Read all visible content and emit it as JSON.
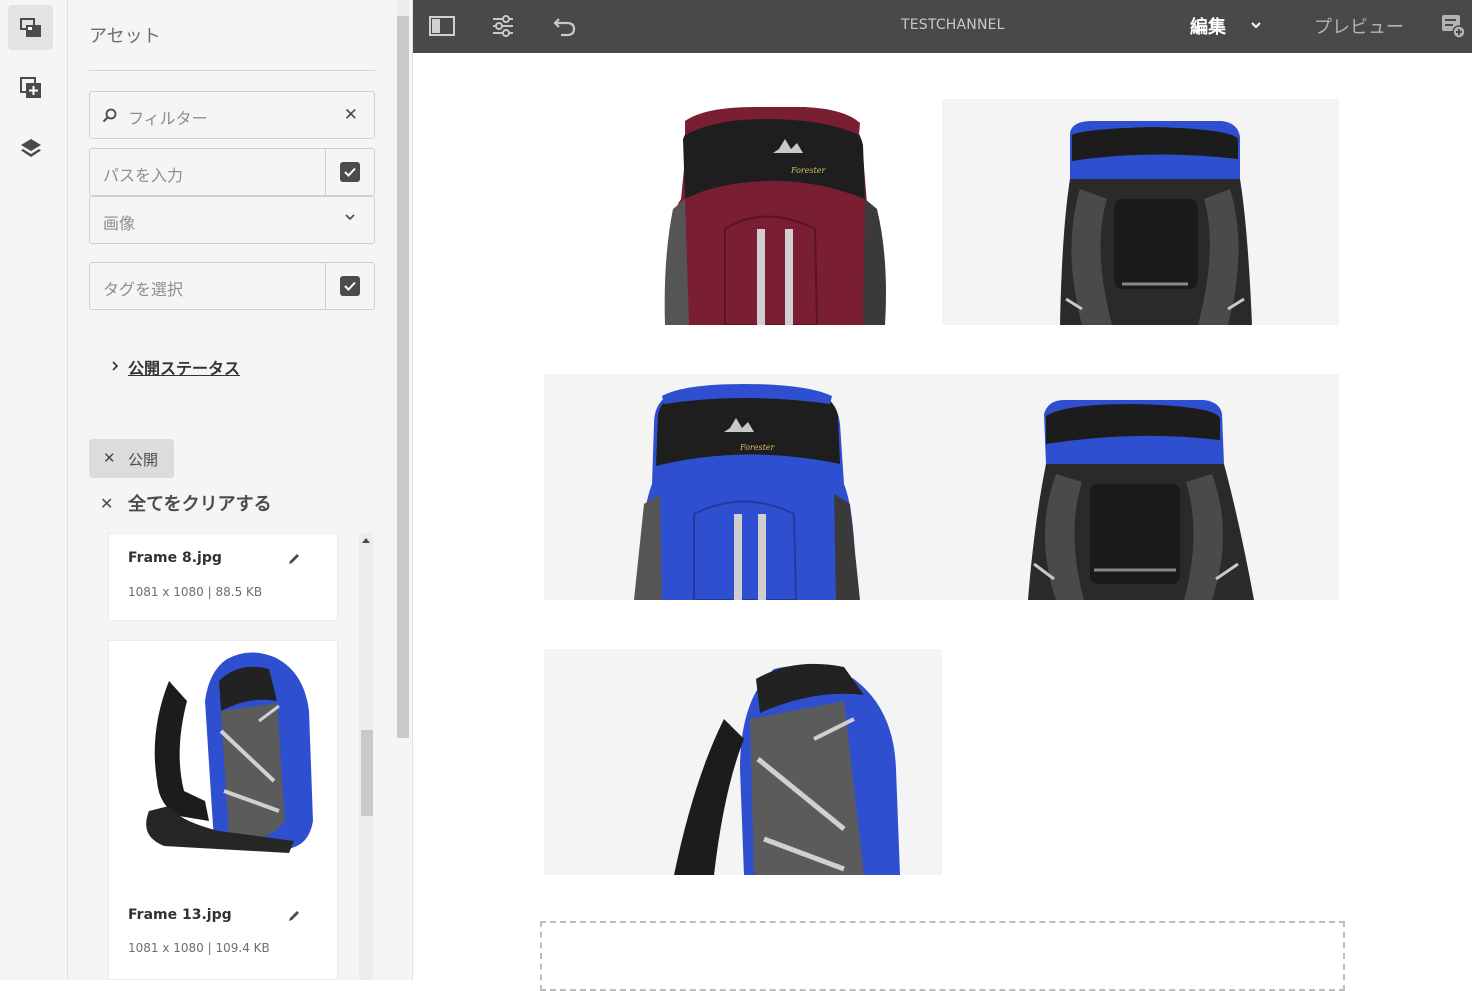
{
  "panel": {
    "title": "アセット",
    "filter_placeholder": "フィルター",
    "path_placeholder": "パスを入力",
    "type_selected": "画像",
    "tag_placeholder": "タグを選択",
    "publish_status_label": "公開ステータス",
    "active_tag": "公開",
    "clear_all_label": "全てをクリアする"
  },
  "assets": [
    {
      "name": "Frame 8.jpg",
      "meta": "1081 x 1080 | 88.5 KB"
    },
    {
      "name": "Frame 13.jpg",
      "meta": "1081 x 1080 | 109.4 KB"
    }
  ],
  "topbar": {
    "title": "TESTCHANNEL",
    "mode_label": "編集",
    "preview_label": "プレビュー"
  },
  "icons": {
    "rail": [
      "assets-icon",
      "components-icon",
      "layers-icon"
    ],
    "topbar": [
      "toggle-side-panel-icon",
      "page-properties-icon",
      "undo-icon",
      "annotate-icon"
    ]
  },
  "colors": {
    "topbar_bg": "#494949",
    "pack_blue": "#2f4fd1",
    "pack_maroon": "#7a1f33",
    "pack_black": "#222222"
  }
}
